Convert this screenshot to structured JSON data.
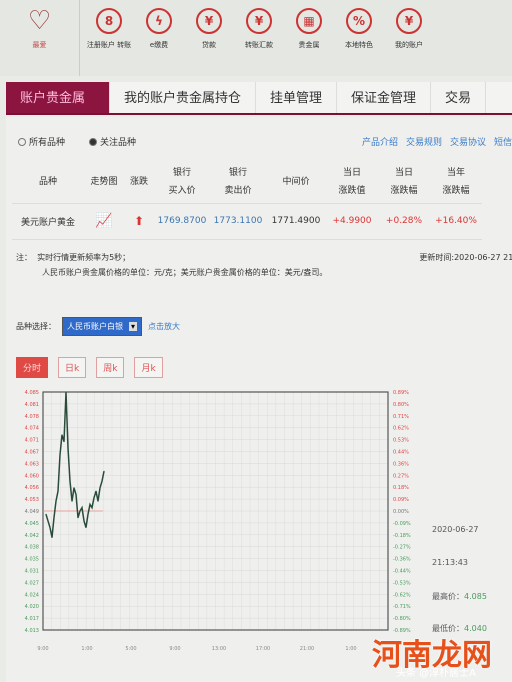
{
  "topnav": [
    {
      "label": "最爱",
      "icon": "heart-icon"
    },
    {
      "label": "注册账户 转账",
      "icon": "account-icon"
    },
    {
      "label": "e缴费",
      "icon": "drop-icon"
    },
    {
      "label": "贷款",
      "icon": "money-bag-icon"
    },
    {
      "label": "转账汇款",
      "icon": "transfer-icon"
    },
    {
      "label": "贵金属",
      "icon": "gold-bars-icon"
    },
    {
      "label": "本地特色",
      "icon": "local-icon"
    },
    {
      "label": "我的账户",
      "icon": "account-yen-icon"
    }
  ],
  "tabs": [
    "账户贵金属",
    "我的账户贵金属持仓",
    "挂单管理",
    "保证金管理",
    "交易"
  ],
  "filters": {
    "all": "所有品种",
    "followed": "关注品种"
  },
  "links": [
    "产品介绍",
    "交易规则",
    "交易协议",
    "短信"
  ],
  "table": {
    "headers": [
      "品种",
      "走势图",
      "涨跌",
      "银行\n买入价",
      "银行\n卖出价",
      "中间价",
      "当日\n涨跌值",
      "当日\n涨跌幅",
      "当年\n涨跌幅"
    ],
    "row": {
      "name": "美元账户黄金",
      "bid": "1769.8700",
      "ask": "1773.1100",
      "mid": "1771.4900",
      "change": "+4.9900",
      "change_pct": "+0.28%",
      "year_pct": "+16.40%"
    }
  },
  "notes": {
    "prefix": "注：",
    "line1": "实时行情更新频率为5秒；",
    "line2": "人民币账户贵金属价格的单位：元/克；美元账户贵金属价格的单位：美元/盎司。",
    "updated": "更新时间:2020-06-27 21:"
  },
  "selector": {
    "label": "品种选择：",
    "value": "人民币账户白银",
    "zoom": "点击放大"
  },
  "period_buttons": [
    "分时",
    "日k",
    "周k",
    "月k"
  ],
  "info": {
    "date": "2020-06-27",
    "time": "21:13:43",
    "high_label": "最高价：",
    "high": "4.085",
    "low_label": "最低价：",
    "low": "4.040"
  },
  "watermark": {
    "text": "河南龙网",
    "sub": "头条 @淳朴居士A"
  },
  "colors": {
    "up": "#d33",
    "down": "#4a9a5a",
    "accent": "#8c1540"
  },
  "chart_data": {
    "type": "line",
    "y_ticks": [
      "4.085",
      "4.081",
      "4.078",
      "4.074",
      "4.071",
      "4.067",
      "4.063",
      "4.060",
      "4.056",
      "4.053",
      "4.049",
      "4.045",
      "4.042",
      "4.038",
      "4.035",
      "4.031",
      "4.027",
      "4.024",
      "4.020",
      "4.017",
      "4.013"
    ],
    "pct_ticks": [
      "0.89%",
      "0.80%",
      "0.71%",
      "0.62%",
      "0.53%",
      "0.44%",
      "0.36%",
      "0.27%",
      "0.18%",
      "0.09%",
      "0.00%",
      "-0.09%",
      "-0.18%",
      "-0.27%",
      "-0.36%",
      "-0.44%",
      "-0.53%",
      "-0.62%",
      "-0.71%",
      "-0.80%",
      "-0.89%"
    ],
    "x_ticks": [
      "9:00",
      "1:00",
      "5:00",
      "9:00",
      "13:00",
      "17:00",
      "21:00",
      "1:00"
    ],
    "ylim": [
      4.013,
      4.085
    ],
    "baseline": 4.049,
    "values": [
      4.048,
      4.046,
      4.044,
      4.041,
      4.047,
      4.052,
      4.055,
      4.066,
      4.072,
      4.07,
      4.085,
      4.068,
      4.058,
      4.052,
      4.056,
      4.054,
      4.047,
      4.049,
      4.05,
      4.046,
      4.044,
      4.048,
      4.051,
      4.05,
      4.053,
      4.055,
      4.052,
      4.056,
      4.058,
      4.061
    ],
    "grid": true
  }
}
